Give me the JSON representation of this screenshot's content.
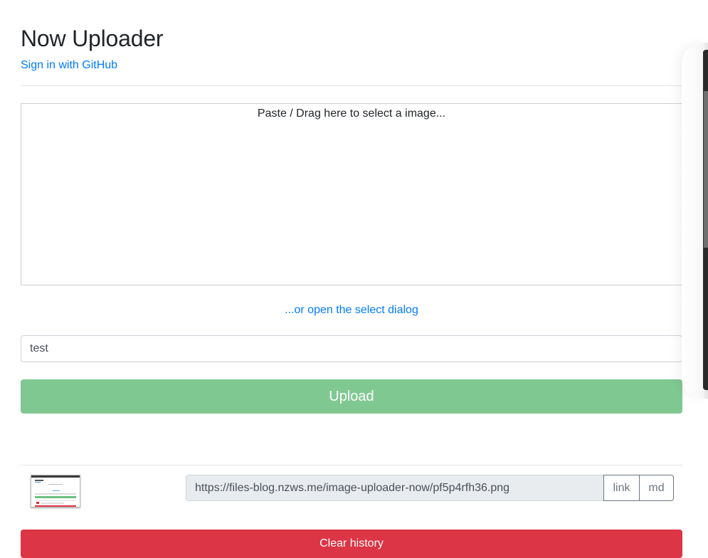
{
  "header": {
    "title": "Now Uploader",
    "signin_label": "Sign in with GitHub"
  },
  "dropzone": {
    "text": "Paste / Drag here to select a image..."
  },
  "select_dialog_label": "...or open the select dialog",
  "name_input": {
    "value": "test"
  },
  "upload_button": {
    "label": "Upload",
    "color": "#80c892"
  },
  "history": {
    "items": [
      {
        "thumbnail_icon": "screenshot-thumbnail",
        "url": "https://files-blog.nzws.me/image-uploader-now/pf5p4rfh36.png",
        "link_label": "link",
        "md_label": "md"
      }
    ],
    "clear_label": "Clear history",
    "clear_color": "#dc3545"
  },
  "colors": {
    "link": "#007bff",
    "text": "#212529"
  }
}
